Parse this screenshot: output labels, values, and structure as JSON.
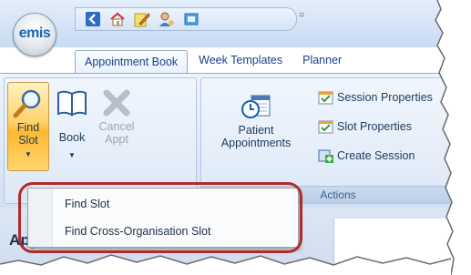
{
  "app": {
    "logo_text": "emis"
  },
  "quick_access": {
    "icons": [
      "back-icon",
      "home-icon",
      "edit-icon",
      "user-icon",
      "switch-icon"
    ],
    "more_symbol": "="
  },
  "tabs": [
    {
      "label": "Appointment Book",
      "active": true
    },
    {
      "label": "Week Templates",
      "active": false
    },
    {
      "label": "Planner",
      "active": false
    }
  ],
  "ribbon": {
    "find_slot": {
      "line1": "Find",
      "line2": "Slot"
    },
    "book": {
      "label": "Book"
    },
    "cancel": {
      "line1": "Cancel",
      "line2": "Appt"
    },
    "patient_appointments": {
      "line1": "Patient",
      "line2": "Appointments"
    },
    "session_properties": "Session Properties",
    "slot_properties": "Slot Properties",
    "create_session": "Create Session",
    "actions_group_label": "Actions"
  },
  "menu": {
    "items": [
      "Find Slot",
      "Find Cross-Organisation Slot"
    ]
  },
  "lower": {
    "title": "Appointm"
  },
  "colors": {
    "highlight": "#b22b2b",
    "accent": "#ffb830"
  }
}
